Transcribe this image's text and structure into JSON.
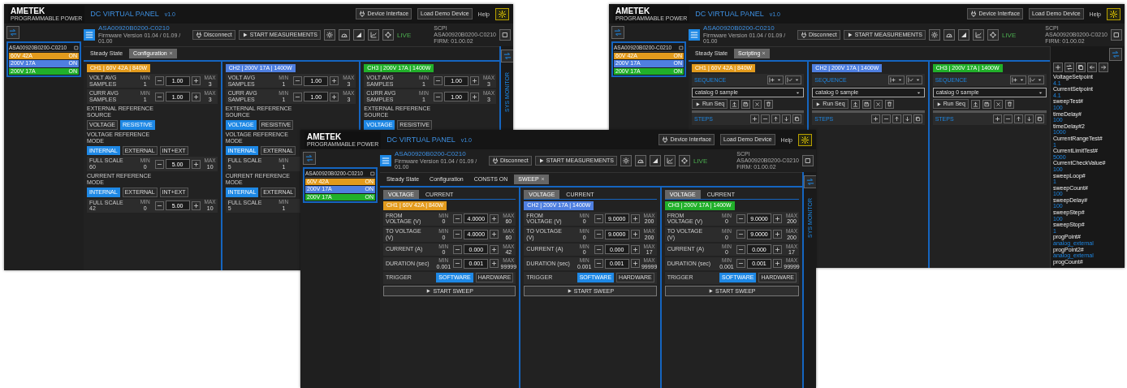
{
  "windows": [
    {
      "logo": "AMETEK",
      "logo_sub": "PROGRAMMABLE POWER",
      "title": "DC VIRTUAL PANEL",
      "version": "v1.0",
      "header_buttons": [
        "Device Interface",
        "Load Demo Device"
      ],
      "user": "Help",
      "device": {
        "name": "ASA00920B0200-C0210",
        "subtitle": "Firmware Version 01.04 / 01.09 / 01.00"
      },
      "device_buttons": [
        "Disconnect",
        "START MEASUREMENTS"
      ],
      "status": "LIVE",
      "info": [
        "SCPI",
        "ASA00920B0200-C0210",
        "FIRM: 01.00.02"
      ],
      "device_list": {
        "name": "ASA00920B0200-C0210",
        "channels": [
          {
            "label": "60V 42A",
            "state": "ON",
            "color": "#e39b1d"
          },
          {
            "label": "200V 17A",
            "state": "ON",
            "color": "#4f7fe0"
          },
          {
            "label": "200V 17A",
            "state": "ON",
            "color": "#21b02a"
          }
        ]
      },
      "tabs": [
        {
          "label": "Steady State",
          "selected": false,
          "closable": false
        },
        {
          "label": "Configuration",
          "selected": true,
          "closable": true
        }
      ],
      "channels": [
        {
          "header": "CH1 | 60V 42A | 840W",
          "color": "#e39b1d",
          "rows": [
            {
              "kind": "spin",
              "label": "VOLT AVG",
              "sublabel": "SAMPLES",
              "min_label": "MIN",
              "min": "1",
              "value": "1.00",
              "max_label": "MAX",
              "max": "3"
            },
            {
              "kind": "spin",
              "label": "CURR AVG",
              "sublabel": "SAMPLES",
              "min_label": "MIN",
              "min": "1",
              "value": "1.00",
              "max_label": "MAX",
              "max": "3"
            },
            {
              "kind": "section",
              "label": "EXTERNAL REFERENCE SOURCE"
            },
            {
              "kind": "toggle",
              "options": [
                {
                  "label": "VOLTAGE",
                  "selected": false
                },
                {
                  "label": "RESISTIVE",
                  "selected": true
                }
              ]
            },
            {
              "kind": "section",
              "label": "VOLTAGE REFERENCE MODE"
            },
            {
              "kind": "toggle",
              "options": [
                {
                  "label": "INTERNAL",
                  "selected": true
                },
                {
                  "label": "EXTERNAL",
                  "selected": false
                },
                {
                  "label": "INT+EXT",
                  "selected": false
                }
              ]
            },
            {
              "kind": "spin",
              "label": "FULL SCALE",
              "sublabel": "60",
              "min_label": "MIN",
              "min": "0",
              "value": "5.00",
              "max_label": "MAX",
              "max": "10"
            },
            {
              "kind": "section",
              "label": "CURRENT REFERENCE MODE"
            },
            {
              "kind": "toggle",
              "options": [
                {
                  "label": "INTERNAL",
                  "selected": true
                },
                {
                  "label": "EXTERNAL",
                  "selected": false
                },
                {
                  "label": "INT+EXT",
                  "selected": false
                }
              ]
            },
            {
              "kind": "spin",
              "label": "FULL SCALE",
              "sublabel": "42",
              "min_label": "MIN",
              "min": "0",
              "value": "5.00",
              "max_label": "MAX",
              "max": "10"
            }
          ]
        },
        {
          "header": "CH2 | 200V 17A | 1400W",
          "color": "#4f7fe0",
          "rows": [
            {
              "kind": "spin",
              "label": "VOLT AVG",
              "sublabel": "SAMPLES",
              "min_label": "MIN",
              "min": "1",
              "value": "1.00",
              "max_label": "MAX",
              "max": "3"
            },
            {
              "kind": "spin",
              "label": "CURR AVG",
              "sublabel": "SAMPLES",
              "min_label": "MIN",
              "min": "1",
              "value": "1.00",
              "max_label": "MAX",
              "max": "3"
            },
            {
              "kind": "section",
              "label": "EXTERNAL REFERENCE SOURCE"
            },
            {
              "kind": "toggle",
              "options": [
                {
                  "label": "VOLTAGE",
                  "selected": true
                },
                {
                  "label": "RESISTIVE",
                  "selected": false
                }
              ]
            },
            {
              "kind": "section",
              "label": "VOLTAGE REFERENCE MODE"
            },
            {
              "kind": "toggle",
              "options": [
                {
                  "label": "INTERNAL",
                  "selected": true
                },
                {
                  "label": "EXTERNAL",
                  "selected": false
                }
              ]
            },
            {
              "kind": "spin",
              "label": "FULL SCALE",
              "sublabel": "5",
              "min_label": "MIN",
              "min": "1"
            },
            {
              "kind": "section",
              "label": "CURRENT REFERENCE MODE"
            },
            {
              "kind": "toggle",
              "options": [
                {
                  "label": "INTERNAL",
                  "selected": true
                },
                {
                  "label": "EXTERNAL",
                  "selected": false
                }
              ]
            },
            {
              "kind": "spin",
              "label": "FULL SCALE",
              "sublabel": "5",
              "min_label": "MIN",
              "min": "1"
            }
          ]
        },
        {
          "header": "CH3 | 200V 17A | 1400W",
          "color": "#21b02a",
          "rows": [
            {
              "kind": "spin",
              "label": "VOLT AVG",
              "sublabel": "SAMPLES",
              "min_label": "MIN",
              "min": "1",
              "value": "1.00",
              "max_label": "MAX",
              "max": "3"
            },
            {
              "kind": "spin",
              "label": "CURR AVG",
              "sublabel": "SAMPLES",
              "min_label": "MIN",
              "min": "1",
              "value": "1.00",
              "max_label": "MAX",
              "max": "3"
            },
            {
              "kind": "section",
              "label": "EXTERNAL REFERENCE SOURCE"
            },
            {
              "kind": "toggle",
              "options": [
                {
                  "label": "VOLTAGE",
                  "selected": true
                },
                {
                  "label": "RESISTIVE",
                  "selected": false
                }
              ]
            }
          ]
        }
      ],
      "side_panel": {
        "kind": "monitor",
        "label": "SYS MONITOR"
      }
    },
    {
      "logo": "AMETEK",
      "logo_sub": "PROGRAMMABLE POWER",
      "title": "DC VIRTUAL PANEL",
      "version": "v1.0",
      "header_buttons": [
        "Device Interface",
        "Load Demo Device"
      ],
      "user": "Help",
      "device": {
        "name": "ASA00920B0200-C0210",
        "subtitle": "Firmware Version 01.04 / 01.09 / 01.00"
      },
      "device_buttons": [
        "Disconnect",
        "START MEASUREMENTS"
      ],
      "status": "LIVE",
      "info": [
        "SCPI",
        "ASA00920B0200-C0210",
        "FIRM: 01.00.02"
      ],
      "device_list": {
        "name": "ASA00920B0200-C0210",
        "channels": [
          {
            "label": "60V 42A",
            "state": "ON",
            "color": "#e39b1d"
          },
          {
            "label": "200V 17A",
            "state": "ON",
            "color": "#4f7fe0"
          },
          {
            "label": "200V 17A",
            "state": "ON",
            "color": "#21b02a"
          }
        ]
      },
      "tabs": [
        {
          "label": "Steady State",
          "selected": false,
          "closable": false
        },
        {
          "label": "Scripting",
          "selected": true,
          "closable": true
        }
      ],
      "channels": [
        {
          "header": "CH1 | 60V 42A | 840W",
          "color": "#e39b1d",
          "rows": [
            {
              "kind": "sequence",
              "label": "SEQUENCE"
            },
            {
              "kind": "select",
              "value": "catalog 0 sample"
            },
            {
              "kind": "toolbar",
              "label": "Run Seq"
            },
            {
              "kind": "steps",
              "label": "STEPS"
            }
          ]
        },
        {
          "header": "CH2 | 200V 17A | 1400W",
          "color": "#4f7fe0",
          "rows": [
            {
              "kind": "sequence",
              "label": "SEQUENCE"
            },
            {
              "kind": "select",
              "value": "catalog 0 sample"
            },
            {
              "kind": "toolbar",
              "label": "Run Seq"
            },
            {
              "kind": "steps",
              "label": "STEPS"
            }
          ]
        },
        {
          "header": "CH3 | 200V 17A | 1400W",
          "color": "#21b02a",
          "rows": [
            {
              "kind": "sequence",
              "label": "SEQUENCE"
            },
            {
              "kind": "select",
              "value": "catalog 0 sample"
            },
            {
              "kind": "toolbar",
              "label": "Run Seq"
            },
            {
              "kind": "steps",
              "label": "STEPS"
            }
          ]
        }
      ],
      "side_panel": {
        "kind": "variables",
        "variables": [
          {
            "name": "VoltageSetpoint",
            "value": "4.1"
          },
          {
            "name": "CurrentSetpoint",
            "value": "4.1"
          },
          {
            "name": "sweepTest#",
            "value": "100"
          },
          {
            "name": "timeDelay#",
            "value": "100"
          },
          {
            "name": "timeDelay#2",
            "value": "1000"
          },
          {
            "name": "CurrentRangeTest#",
            "value": "1"
          },
          {
            "name": "CurrentLimitTest#",
            "value": "5000"
          },
          {
            "name": "CurrentCheckValue#",
            "value": "100"
          },
          {
            "name": "sweepLoop#",
            "value": "1"
          },
          {
            "name": "sweepCount#",
            "value": "100"
          },
          {
            "name": "sweepDelay#",
            "value": "100"
          },
          {
            "name": "sweepStep#",
            "value": "100"
          },
          {
            "name": "sweepStop#",
            "value": "1"
          },
          {
            "name": "progPoint#",
            "value": "analog_external"
          },
          {
            "name": "progPoint2#",
            "value": "analog_external"
          },
          {
            "name": "progCount#"
          }
        ]
      }
    },
    {
      "logo": "AMETEK",
      "logo_sub": "PROGRAMMABLE POWER",
      "title": "DC VIRTUAL PANEL",
      "version": "v1.0",
      "header_buttons": [
        "Device Interface",
        "Load Demo Device"
      ],
      "user": "Help",
      "device": {
        "name": "ASA00920B0200-C0210",
        "subtitle": "Firmware Version 01.04 / 01.09 / 01.00"
      },
      "device_buttons": [
        "Disconnect",
        "START MEASUREMENTS"
      ],
      "status": "LIVE",
      "info": [
        "SCPI",
        "ASA00920B0200-C0210",
        "FIRM: 01.00.02"
      ],
      "device_list": {
        "name": "ASA00920B0200-C0210",
        "channels": [
          {
            "label": "60V 42A",
            "state": "ON",
            "color": "#e39b1d"
          },
          {
            "label": "200V 17A",
            "state": "ON",
            "color": "#4f7fe0"
          },
          {
            "label": "200V 17A",
            "state": "ON",
            "color": "#21b02a"
          }
        ]
      },
      "tabs": [
        {
          "label": "Steady State",
          "selected": false,
          "closable": false
        },
        {
          "label": "Configuration",
          "selected": false,
          "closable": false
        },
        {
          "label": "CONSTS ON",
          "selected": false,
          "closable": false
        },
        {
          "label": "SWEEP",
          "selected": true,
          "closable": true
        }
      ],
      "channels": [
        {
          "sub_tabs": [
            {
              "label": "VOLTAGE",
              "selected": true
            },
            {
              "label": "CURRENT",
              "selected": false
            }
          ],
          "header": "CH1 | 60V 42A | 840W",
          "color": "#e39b1d",
          "rows": [
            {
              "kind": "spin",
              "label": "FROM",
              "sublabel": "VOLTAGE (V)",
              "min_label": "MIN",
              "min": "0",
              "value": "4.0000",
              "max_label": "MAX",
              "max": "60"
            },
            {
              "kind": "spin",
              "label": "TO VOLTAGE",
              "sublabel": "(V)",
              "min_label": "MIN",
              "min": "0",
              "value": "4.0000",
              "max_label": "MAX",
              "max": "60"
            },
            {
              "kind": "spin",
              "label": "CURRENT (A)",
              "min_label": "MIN",
              "min": "0",
              "value": "0.000",
              "max_label": "MAX",
              "max": "42"
            },
            {
              "kind": "spin",
              "label": "DURATION (sec)",
              "min_label": "MIN",
              "min": "0.001",
              "value": "0.001",
              "max_label": "MAX",
              "max": "99999"
            },
            {
              "kind": "trigger",
              "label": "TRIGGER",
              "options": [
                {
                  "label": "SOFTWARE",
                  "selected": true
                },
                {
                  "label": "HARDWARE",
                  "selected": false
                }
              ]
            },
            {
              "kind": "action",
              "label": "START SWEEP"
            }
          ]
        },
        {
          "sub_tabs": [
            {
              "label": "VOLTAGE",
              "selected": true
            },
            {
              "label": "CURRENT",
              "selected": false
            }
          ],
          "header": "CH2 | 200V 17A | 1400W",
          "color": "#4f7fe0",
          "rows": [
            {
              "kind": "spin",
              "label": "FROM",
              "sublabel": "VOLTAGE (V)",
              "min_label": "MIN",
              "min": "0",
              "value": "9.0000",
              "max_label": "MAX",
              "max": "200"
            },
            {
              "kind": "spin",
              "label": "TO VOLTAGE",
              "sublabel": "(V)",
              "min_label": "MIN",
              "min": "0",
              "value": "9.0000",
              "max_label": "MAX",
              "max": "200"
            },
            {
              "kind": "spin",
              "label": "CURRENT (A)",
              "min_label": "MIN",
              "min": "0",
              "value": "0.000",
              "max_label": "MAX",
              "max": "17"
            },
            {
              "kind": "spin",
              "label": "DURATION (sec)",
              "min_label": "MIN",
              "min": "0.001",
              "value": "0.001",
              "max_label": "MAX",
              "max": "99999"
            },
            {
              "kind": "trigger",
              "label": "TRIGGER",
              "options": [
                {
                  "label": "SOFTWARE",
                  "selected": true
                },
                {
                  "label": "HARDWARE",
                  "selected": false
                }
              ]
            },
            {
              "kind": "action",
              "label": "START SWEEP"
            }
          ]
        },
        {
          "sub_tabs": [
            {
              "label": "VOLTAGE",
              "selected": true
            },
            {
              "label": "CURRENT",
              "selected": false
            }
          ],
          "header": "CH3 | 200V 17A | 1400W",
          "color": "#21b02a",
          "rows": [
            {
              "kind": "spin",
              "label": "FROM",
              "sublabel": "VOLTAGE (V)",
              "min_label": "MIN",
              "min": "0",
              "value": "9.0000",
              "max_label": "MAX",
              "max": "200"
            },
            {
              "kind": "spin",
              "label": "TO VOLTAGE",
              "sublabel": "(V)",
              "min_label": "MIN",
              "min": "0",
              "value": "9.0000",
              "max_label": "MAX",
              "max": "200"
            },
            {
              "kind": "spin",
              "label": "CURRENT (A)",
              "min_label": "MIN",
              "min": "0",
              "value": "0.000",
              "max_label": "MAX",
              "max": "17"
            },
            {
              "kind": "spin",
              "label": "DURATION (sec)",
              "min_label": "MIN",
              "min": "0.001",
              "value": "0.001",
              "max_label": "MAX",
              "max": "99999"
            },
            {
              "kind": "trigger",
              "label": "TRIGGER",
              "options": [
                {
                  "label": "SOFTWARE",
                  "selected": true
                },
                {
                  "label": "HARDWARE",
                  "selected": false
                }
              ]
            },
            {
              "kind": "action",
              "label": "START SWEEP"
            }
          ]
        }
      ],
      "side_panel": {
        "kind": "monitor",
        "label": "SYS MONITOR"
      }
    }
  ]
}
